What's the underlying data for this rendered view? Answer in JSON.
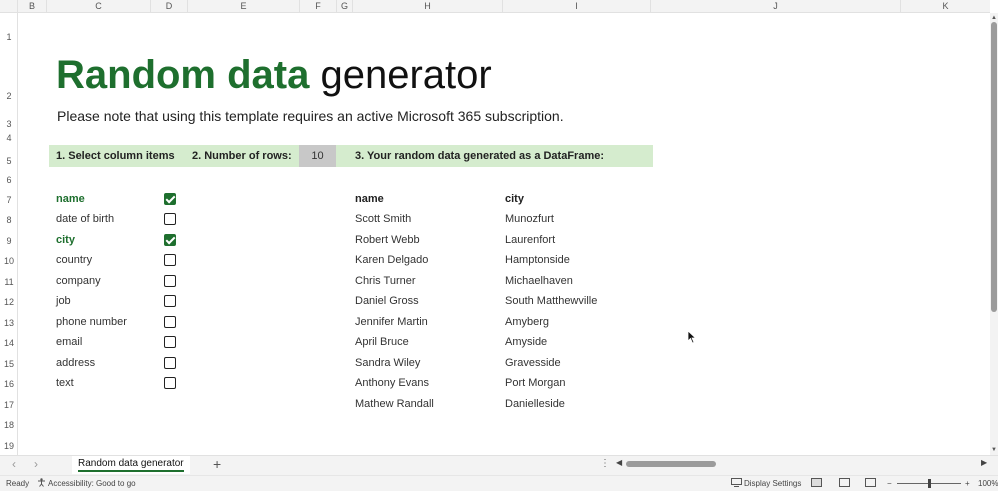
{
  "columns": [
    "B",
    "C",
    "D",
    "E",
    "F",
    "G",
    "H",
    "I",
    "J",
    "K"
  ],
  "rows": [
    "1",
    "2",
    "3",
    "4",
    "5",
    "6",
    "7",
    "8",
    "9",
    "10",
    "11",
    "12",
    "13",
    "14",
    "15",
    "16",
    "17",
    "18",
    "19"
  ],
  "title_bold": "Random data",
  "title_rest": "generator",
  "subtitle": "Please note that using this template requires an active Microsoft 365 subscription.",
  "band": {
    "step1": "1. Select column items",
    "step2": "2. Number of rows:",
    "rows_value": "10",
    "step3": "3. Your random data generated as a DataFrame:"
  },
  "column_items": [
    {
      "label": "name",
      "checked": true
    },
    {
      "label": "date of birth",
      "checked": false
    },
    {
      "label": "city",
      "checked": true
    },
    {
      "label": "country",
      "checked": false
    },
    {
      "label": "company",
      "checked": false
    },
    {
      "label": "job",
      "checked": false
    },
    {
      "label": "phone number",
      "checked": false
    },
    {
      "label": "email",
      "checked": false
    },
    {
      "label": "address",
      "checked": false
    },
    {
      "label": "text",
      "checked": false
    }
  ],
  "dataframe": {
    "headers": [
      "name",
      "city"
    ],
    "rows": [
      [
        "Scott Smith",
        "Munozfurt"
      ],
      [
        "Robert Webb",
        "Laurenfort"
      ],
      [
        "Karen Delgado",
        "Hamptonside"
      ],
      [
        "Chris Turner",
        "Michaelhaven"
      ],
      [
        "Daniel Gross",
        "South Matthewville"
      ],
      [
        "Jennifer Martin",
        "Amyberg"
      ],
      [
        "April Bruce",
        "Amyside"
      ],
      [
        "Sandra Wiley",
        "Gravesside"
      ],
      [
        "Anthony Evans",
        "Port Morgan"
      ],
      [
        "Mathew Randall",
        "Danielleside"
      ]
    ]
  },
  "sheet_tab": "Random data generator",
  "add_sheet": "+",
  "status": {
    "ready": "Ready",
    "accessibility": "Accessibility: Good to go",
    "display_settings": "Display Settings",
    "zoom_minus": "−",
    "zoom_plus": "+",
    "zoom": "100%"
  },
  "colors": {
    "accent_green": "#1e6f2e",
    "band": "#d5ecce"
  }
}
